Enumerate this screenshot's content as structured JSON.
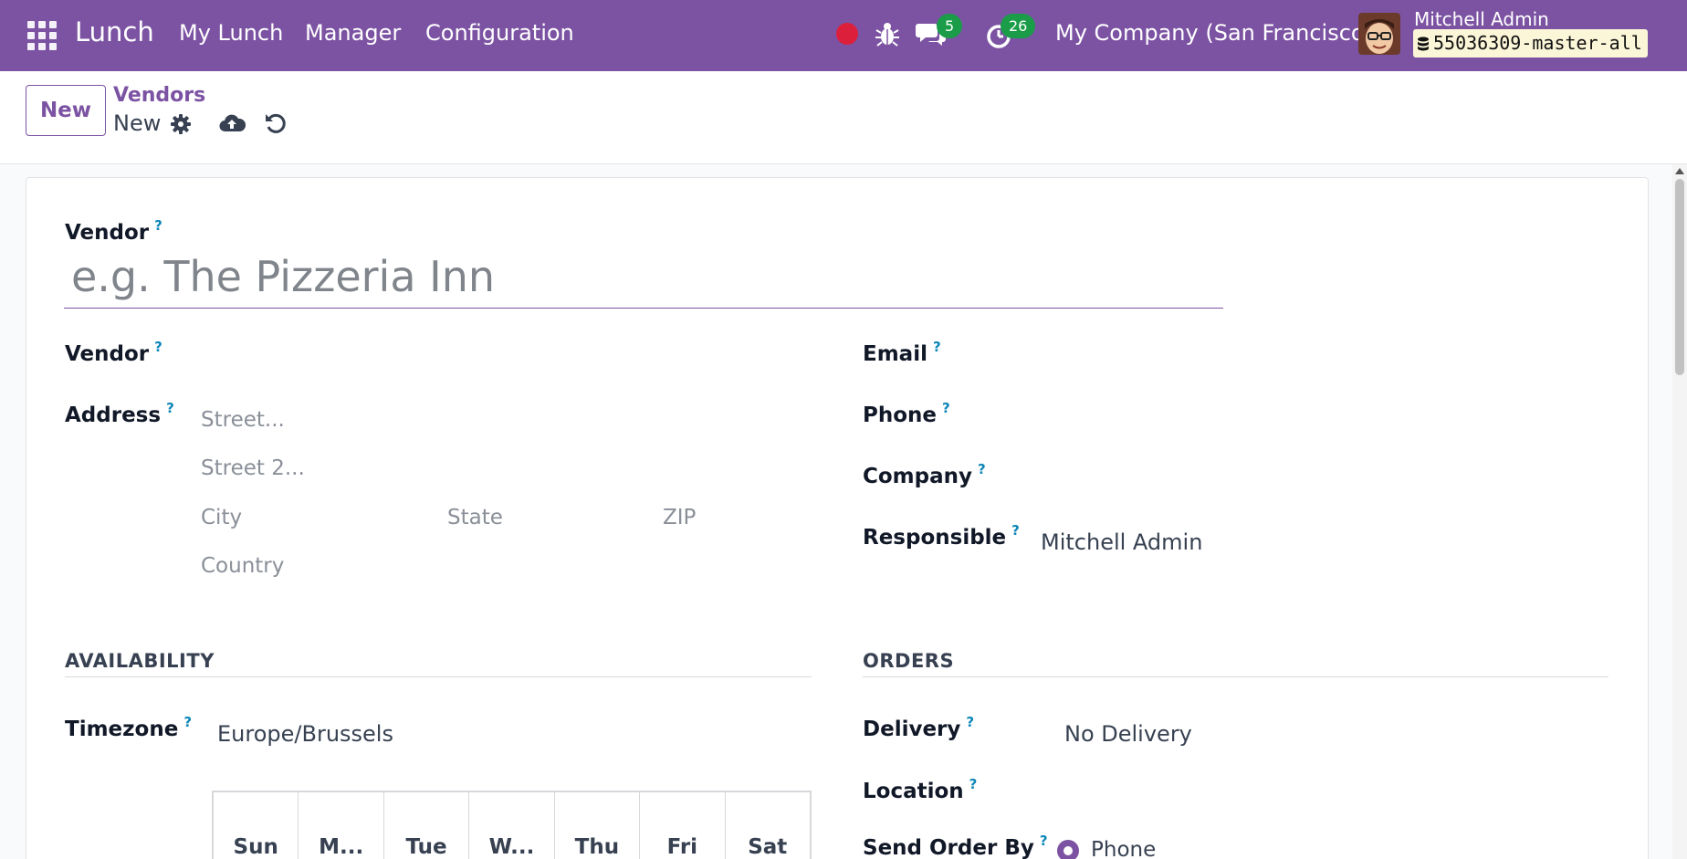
{
  "navbar": {
    "app_name": "Lunch",
    "menu": [
      "My Lunch",
      "Manager",
      "Configuration"
    ],
    "messages_count": "5",
    "activities_count": "26",
    "company": "My Company (San Francisco)",
    "user_name": "Mitchell Admin",
    "database": "55036309-master-all",
    "accent_color": "#7c53a3"
  },
  "control": {
    "new_button": "New",
    "breadcrumb_parent": "Vendors",
    "breadcrumb_current": "New"
  },
  "form": {
    "name_label": "Vendor",
    "name_placeholder": "e.g. The Pizzeria Inn",
    "help_mark": "?",
    "left": {
      "vendor_label": "Vendor",
      "address_label": "Address",
      "street_ph": "Street...",
      "street2_ph": "Street 2...",
      "city_ph": "City",
      "state_ph": "State",
      "zip_ph": "ZIP",
      "country_ph": "Country"
    },
    "right": {
      "email_label": "Email",
      "phone_label": "Phone",
      "company_label": "Company",
      "responsible_label": "Responsible",
      "responsible_value": "Mitchell Admin"
    },
    "availability": {
      "title": "AVAILABILITY",
      "timezone_label": "Timezone",
      "timezone_value": "Europe/Brussels",
      "days": [
        "Sun",
        "M...",
        "Tue",
        "W...",
        "Thu",
        "Fri",
        "Sat"
      ]
    },
    "orders": {
      "title": "ORDERS",
      "delivery_label": "Delivery",
      "delivery_value": "No Delivery",
      "location_label": "Location",
      "send_order_label": "Send Order By",
      "send_order_value": "Phone"
    }
  }
}
